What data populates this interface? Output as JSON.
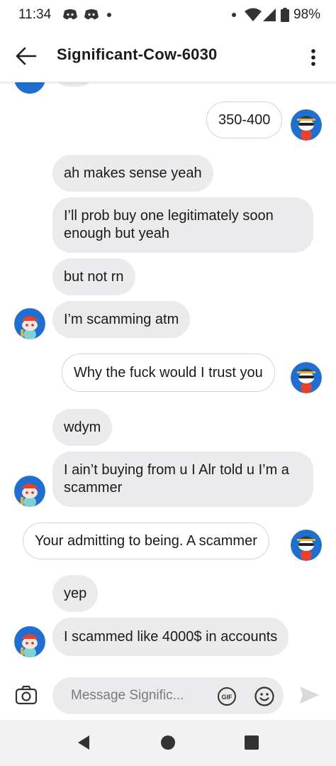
{
  "status_bar": {
    "time": "11:34",
    "battery": "98%",
    "icons": [
      "discord-icon",
      "discord-icon",
      "dot-icon",
      "dot-icon",
      "wifi-icon",
      "signal-icon",
      "battery-icon"
    ]
  },
  "header": {
    "title": "Significant-Cow-6030",
    "icons": [
      "back-arrow-icon",
      "more-vertical-icon"
    ]
  },
  "messages": [
    {
      "from": "me",
      "text": "350-400"
    },
    {
      "from": "them",
      "text": "ah makes sense yeah"
    },
    {
      "from": "them",
      "text": "I’ll prob buy one legitimately soon enough but yeah"
    },
    {
      "from": "them",
      "text": "but not rn"
    },
    {
      "from": "them",
      "text": "I’m scamming atm"
    },
    {
      "from": "me",
      "text": "Why the fuck would I trust you"
    },
    {
      "from": "them",
      "text": "wdym"
    },
    {
      "from": "them",
      "text": "I ain’t buying from u I Alr told u I’m a scammer"
    },
    {
      "from": "me",
      "text": "Your admitting to being. A scammer"
    },
    {
      "from": "them",
      "text": "yep"
    },
    {
      "from": "them",
      "text": "I scammed like 4000$ in accounts"
    }
  ],
  "composer": {
    "placeholder": "Message Signific...",
    "icons": [
      "camera-icon",
      "gif-icon",
      "emoji-icon",
      "send-icon"
    ]
  },
  "navbar": {
    "icons": [
      "nav-back-icon",
      "nav-home-icon",
      "nav-recents-icon"
    ]
  },
  "colors": {
    "incoming_bubble": "#ebebed",
    "outgoing_border": "#d4d4d6",
    "avatar_bg": "#1f6fd1",
    "navbar_bg": "#f2f2f2"
  }
}
